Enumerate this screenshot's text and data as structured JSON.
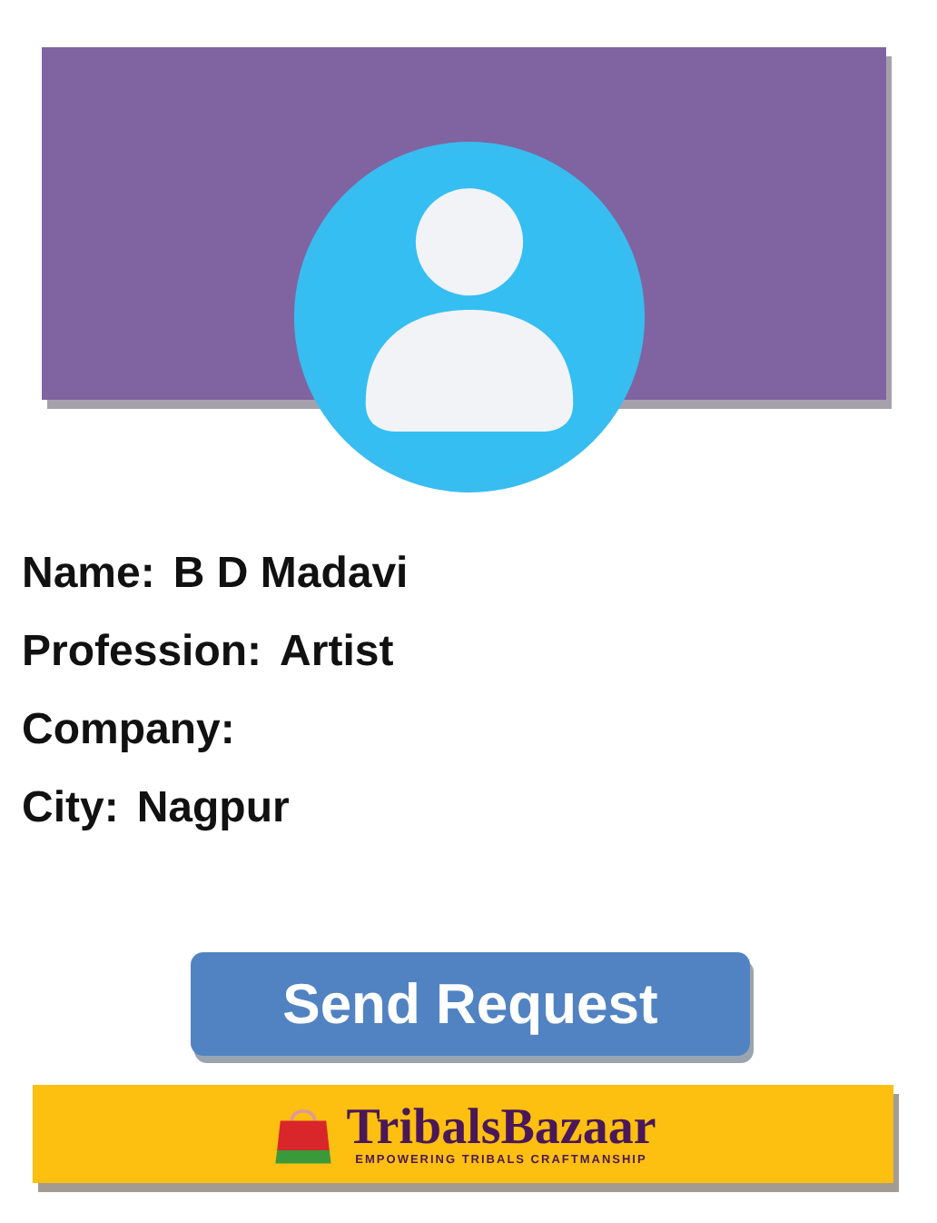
{
  "profile": {
    "fields": [
      {
        "label": "Name:",
        "value": "B D Madavi"
      },
      {
        "label": "Profession:",
        "value": "Artist"
      },
      {
        "label": "Company:"
      },
      {
        "label": "City:",
        "value": "Nagpur"
      }
    ]
  },
  "action": {
    "label": "Send Request"
  },
  "footer": {
    "brand": "TribalsBazaar",
    "tagline": "EMPOWERING TRIBALS CRAFTMANSHIP"
  }
}
